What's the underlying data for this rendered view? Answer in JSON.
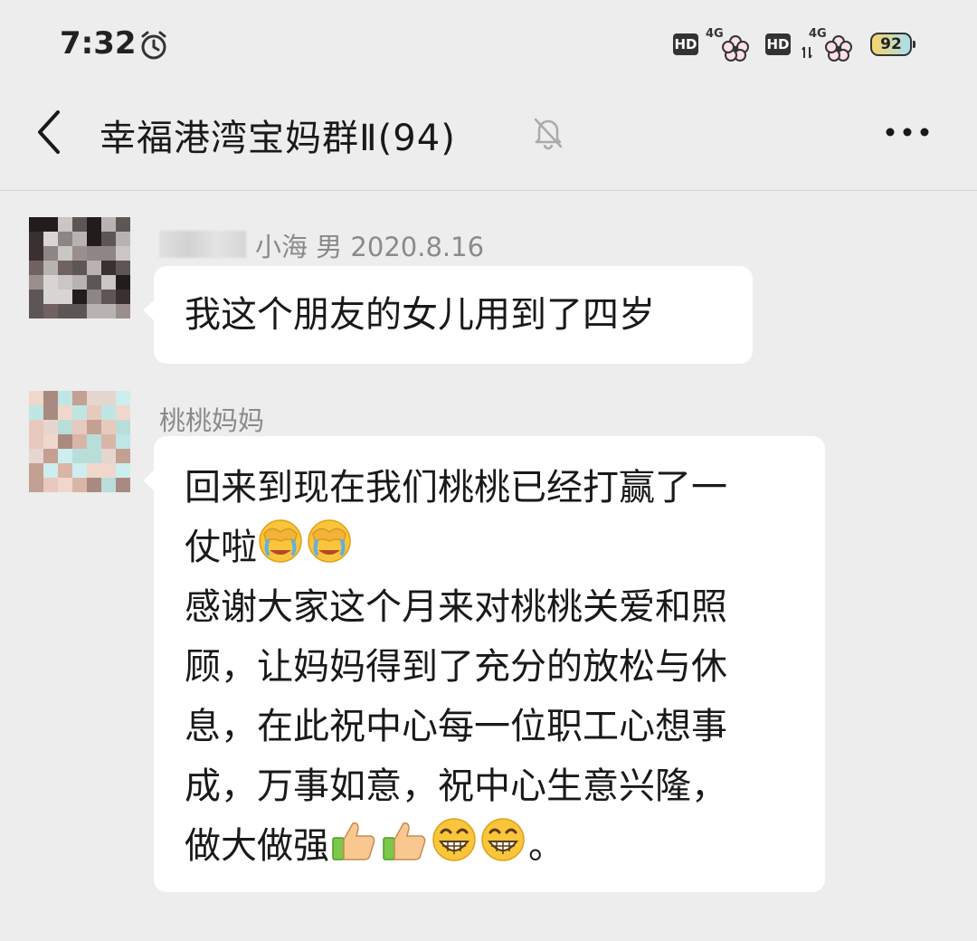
{
  "status_bar": {
    "time": "7:32",
    "hd1": "HD",
    "net1": "4G",
    "hd2": "HD",
    "net2": "4G",
    "battery": "92"
  },
  "header": {
    "title": "幸福港湾宝妈群Ⅱ(94)",
    "icons": [
      "back-icon",
      "mute-bell-icon",
      "more-icon"
    ]
  },
  "messages": [
    {
      "sender": "小海 男 2020.8.16",
      "text": "我这个朋友的女儿用到了四岁"
    },
    {
      "sender": "桃桃妈妈",
      "lines": [
        "回来到现在我们桃桃已经打赢了一",
        "仗啦",
        "感谢大家这个月来对桃桃关爱和照",
        "顾，让妈妈得到了充分的放松与休",
        "息，在此祝中心每一位职工心想事",
        "成，万事如意，祝中心生意兴隆，",
        "做大做强",
        "。"
      ],
      "emojis": [
        "facepalm-cry-emoji",
        "facepalm-cry-emoji",
        "thumbs-up-emoji",
        "thumbs-up-emoji",
        "grin-emoji",
        "grin-emoji"
      ]
    }
  ],
  "colors": {
    "background": "#ededed",
    "bubble": "#ffffff",
    "sender_text": "#8a8a8a"
  }
}
